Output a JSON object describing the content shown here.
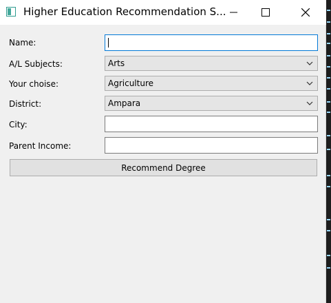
{
  "window": {
    "title": "Higher Education Recommendation S..."
  },
  "form": {
    "name_label": "Name:",
    "name_value": "",
    "subjects_label": "A/L Subjects:",
    "subjects_value": "Arts",
    "choise_label": "Your choise:",
    "choise_value": "Agriculture",
    "district_label": "District:",
    "district_value": "Ampara",
    "city_label": "City:",
    "city_value": "",
    "income_label": "Parent Income:",
    "income_value": "",
    "submit_label": "Recommend Degree"
  },
  "icons": {
    "app": "app-icon",
    "minimize": "minimize-icon",
    "maximize": "maximize-icon",
    "close": "close-icon",
    "dropdown": "chevron-down-icon"
  }
}
